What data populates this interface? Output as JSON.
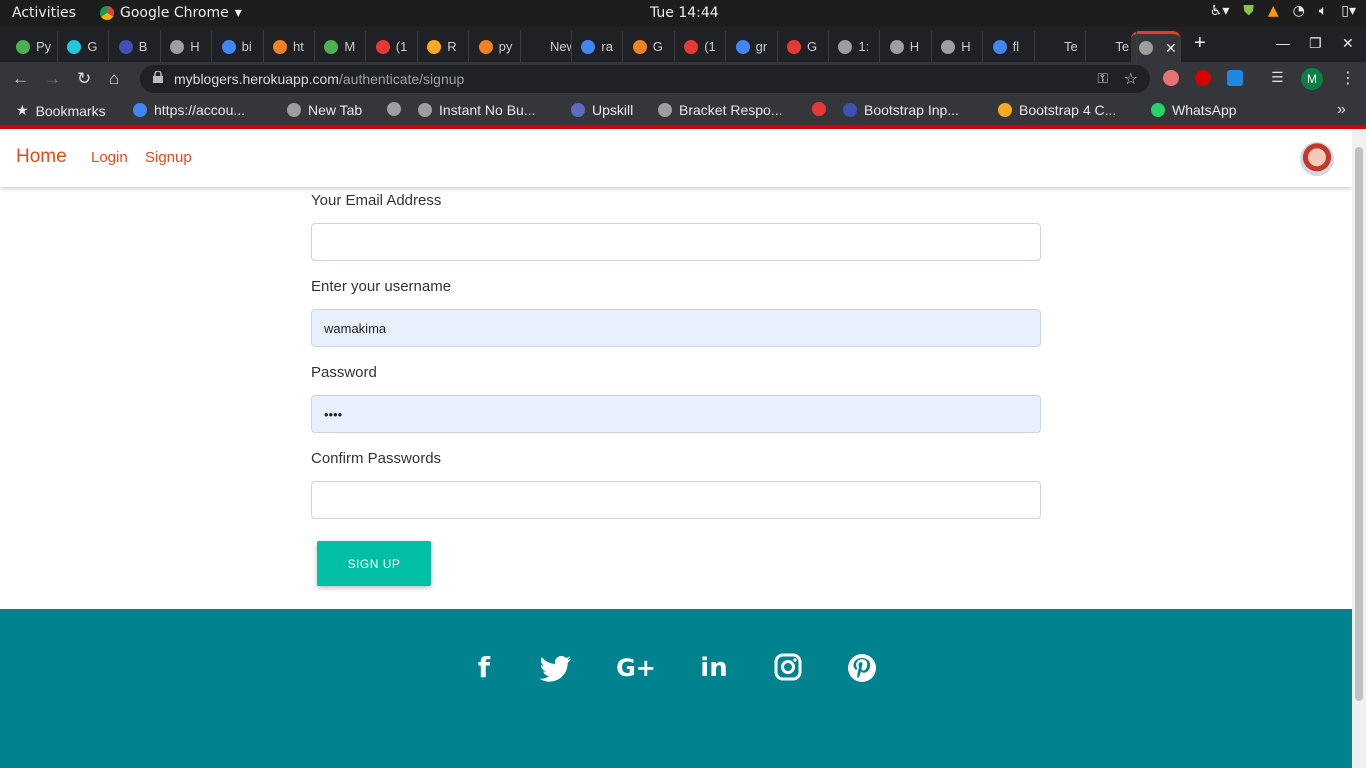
{
  "os_bar": {
    "activities": "Activities",
    "app_name": "Google Chrome",
    "clock": "Tue 14:44"
  },
  "tabs": [
    {
      "label": "Py",
      "color": "#4caf50"
    },
    {
      "label": "G",
      "color": "#26c6da"
    },
    {
      "label": "B",
      "color": "#3f51b5"
    },
    {
      "label": "H",
      "color": "#9e9e9e"
    },
    {
      "label": "bi",
      "color": "#4285f4"
    },
    {
      "label": "ht",
      "color": "#f48024"
    },
    {
      "label": "M",
      "color": "#4caf50"
    },
    {
      "label": "(1",
      "color": "#e53935"
    },
    {
      "label": "R",
      "color": "#f9a825"
    },
    {
      "label": "py",
      "color": "#f48024"
    },
    {
      "label": "New",
      "color": "#202124"
    },
    {
      "label": "ra",
      "color": "#4285f4"
    },
    {
      "label": "G",
      "color": "#f48024"
    },
    {
      "label": "(1",
      "color": "#e53935"
    },
    {
      "label": "gr",
      "color": "#4285f4"
    },
    {
      "label": "G",
      "color": "#e53935"
    },
    {
      "label": "1:",
      "color": "#9e9e9e"
    },
    {
      "label": "H",
      "color": "#9e9e9e"
    },
    {
      "label": "H",
      "color": "#9e9e9e"
    },
    {
      "label": "fl",
      "color": "#4285f4"
    },
    {
      "label": "Te",
      "color": "#202124"
    },
    {
      "label": "Te",
      "color": "#202124"
    }
  ],
  "address_bar": {
    "domain": "myblogers.herokuapp.com",
    "path": "/authenticate/signup"
  },
  "profile_initial": "M",
  "bookmarks": {
    "label": "Bookmarks",
    "items": [
      {
        "label": "https://accou...",
        "color": "#4285f4"
      },
      {
        "label": "New Tab",
        "color": "#9e9e9e"
      },
      {
        "label": "",
        "color": "#9e9e9e"
      },
      {
        "label": "Instant No Bu...",
        "color": "#9e9e9e"
      },
      {
        "label": "Upskill",
        "color": "#5c6bc0"
      },
      {
        "label": "Bracket Respo...",
        "color": "#9e9e9e"
      },
      {
        "label": "",
        "color": "#e53935"
      },
      {
        "label": "Bootstrap Inp...",
        "color": "#3f51b5"
      },
      {
        "label": "Bootstrap 4 C...",
        "color": "#f9a825"
      },
      {
        "label": "WhatsApp",
        "color": "#25d366"
      }
    ]
  },
  "navbar": {
    "brand": "Home",
    "login": "Login",
    "signup": "Signup"
  },
  "form": {
    "email_label": "Your Email Address",
    "email_value": "",
    "username_label": "Enter your username",
    "username_value": "wamakima",
    "password_label": "Password",
    "password_value": "••••",
    "confirm_label": "Confirm Passwords",
    "confirm_value": "",
    "submit_label": "SIGN UP"
  },
  "footer": {
    "social": [
      "f",
      "twitter",
      "G+",
      "in",
      "instagram",
      "pinterest"
    ]
  },
  "colors": {
    "accent": "#e64a19",
    "button": "#00bfa5",
    "footer": "#00838f",
    "autofill": "#e8f0fe"
  }
}
